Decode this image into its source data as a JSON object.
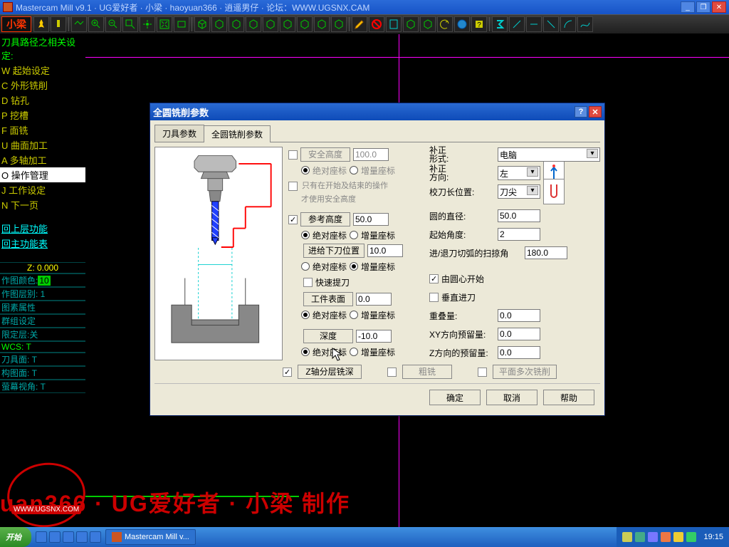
{
  "app": {
    "title": "Mastercam Mill v9.1 · UG爱好者 · 小梁 · haoyuan366 · 逍遥男仔 · 论坛：WWW.UGSNX.CAM",
    "logo": "小梁"
  },
  "sidemenu": {
    "header": "刀具路径之相关设定:",
    "items": [
      {
        "label": "W 起始设定",
        "sel": false
      },
      {
        "label": "C 外形铣削",
        "sel": false
      },
      {
        "label": "D 钻孔",
        "sel": false
      },
      {
        "label": "P 挖槽",
        "sel": false
      },
      {
        "label": "F 面铣",
        "sel": false
      },
      {
        "label": "U 曲面加工",
        "sel": false
      },
      {
        "label": "A 多轴加工",
        "sel": false
      },
      {
        "label": "O 操作管理",
        "sel": true
      },
      {
        "label": "J 工作设定",
        "sel": false
      },
      {
        "label": "N 下一页",
        "sel": false
      }
    ],
    "back1": "回上层功能",
    "back2": "回主功能表",
    "status": {
      "z": "Z: 0.000",
      "color": "作图颜色:",
      "colorval": "10",
      "layer": "作图层别: 1",
      "attr": "图素属性",
      "group": "群组设定",
      "limit": "限定层:关",
      "wcs": "WCS: T",
      "tool": "刀具面: T",
      "cons": "构图面: T",
      "view": "萤幕视角: T"
    }
  },
  "dialog": {
    "title": "全圆铣削参数",
    "tabs": {
      "tool": "刀具参数",
      "circle": "全圆铣削参数"
    },
    "safe_height": {
      "label": "安全高度",
      "value": "100.0",
      "abs": "绝对座标",
      "inc": "增量座标",
      "note1": "只有在开始及结束的操作",
      "note2": "才使用安全高度"
    },
    "ref_height": {
      "label": "参考高度",
      "value": "50.0",
      "abs": "绝对座标",
      "inc": "增量座标",
      "checked": true,
      "abs_sel": true
    },
    "feed_down": {
      "label": "进给下刀位置",
      "value": "10.0",
      "abs": "绝对座标",
      "inc": "增量座标",
      "inc_sel": true,
      "rapid": "快速提刀"
    },
    "work_surface": {
      "label": "工件表面",
      "value": "0.0",
      "abs": "绝对座标",
      "inc": "增量座标",
      "abs_sel": true
    },
    "depth": {
      "label": "深度",
      "value": "-10.0",
      "abs": "绝对座标",
      "inc": "增量座标",
      "abs_sel": true
    },
    "right": {
      "comp_type": {
        "label": "补正\n形式:",
        "value": "电脑"
      },
      "comp_dir": {
        "label": "补正\n方向:",
        "value": "左"
      },
      "tip": {
        "label": "校刀长位置:",
        "value": "刀尖"
      },
      "diameter": {
        "label": "圆的直径:",
        "value": "50.0"
      },
      "start_angle": {
        "label": "起始角度:",
        "value": "2"
      },
      "sweep": {
        "label": "进/退刀切弧的扫掠角",
        "value": "180.0"
      },
      "center_start": {
        "label": "由圆心开始",
        "checked": true
      },
      "perp_feed": {
        "label": "垂直进刀",
        "checked": false
      },
      "overlap": {
        "label": "重叠量:",
        "value": "0.0"
      },
      "xy_stock": {
        "label": "XY方向预留量:",
        "value": "0.0"
      },
      "z_stock": {
        "label": "Z方向的预留量:",
        "value": "0.0"
      }
    },
    "bottom": {
      "z_layers": "Z轴分层铣深",
      "z_checked": true,
      "rough": "粗铣",
      "plane_multi": "平面多次铣削"
    },
    "buttons": {
      "ok": "确定",
      "cancel": "取消",
      "help": "帮助"
    }
  },
  "watermark": "uan366 · UG爱好者 · 小梁  制作",
  "wm_badge": {
    "top": "UG爱好者",
    "url": "WWW.UGSNX.COM"
  },
  "taskbar": {
    "start": "开始",
    "task": "Mastercam Mill v...",
    "clock": "19:15"
  }
}
